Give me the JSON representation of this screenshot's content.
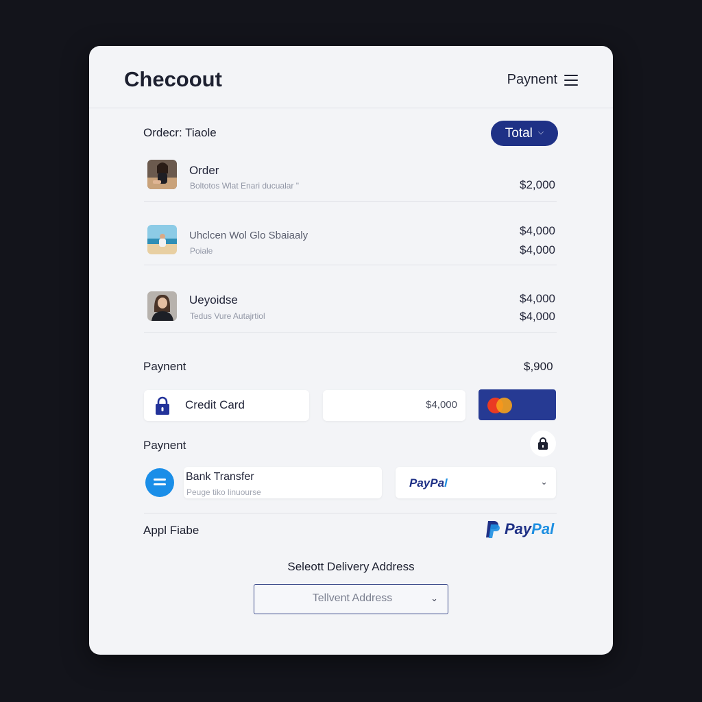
{
  "header": {
    "title": "Checoout",
    "nav_label": "Paynent",
    "menu_icon": "hamburger-icon"
  },
  "order": {
    "section_label": "Ordecr: Tiaole",
    "total_button_label": "Total",
    "items": [
      {
        "name": "Order",
        "subtitle": "Boltotos Wlat Enari ducualar \"",
        "prices": [
          "$2,000"
        ]
      },
      {
        "name": "Uhclcen Wol Glo Sbaiaaly",
        "subtitle": "Poiale",
        "prices": [
          "$4,000",
          "$4,000"
        ]
      },
      {
        "name": "Ueyoidse",
        "subtitle": "Tedus Vure Autajrtiol",
        "prices": [
          "$4,000",
          "$4,000"
        ]
      }
    ]
  },
  "payment": {
    "section_label": "Paynent",
    "amount": "$,900",
    "credit_card": {
      "label": "Credit Card",
      "icon": "lock-icon",
      "amount_value": "$4,000",
      "card_icon": "mastercard-icon"
    },
    "second_label": "Paynent",
    "secure_icon": "lock-icon",
    "bank_transfer": {
      "label": "Bank Transfer",
      "sub": "Peuge tiko linuourse",
      "icon": "bank-icon"
    },
    "paypal_select": {
      "text_a": "PayPa",
      "text_b": "l",
      "selected": "PayPal"
    },
    "apple_label": "Appl Fiabe",
    "paypal_logo": {
      "text_a": "Pay",
      "text_b": "Pal",
      "icon": "paypal-icon"
    }
  },
  "delivery": {
    "label": "Seleott Delivery Address",
    "placeholder": "Tellvent Address"
  },
  "colors": {
    "accent": "#1f3186",
    "bank_blue": "#1a8ee8",
    "mastercard_bg": "#263a93"
  }
}
